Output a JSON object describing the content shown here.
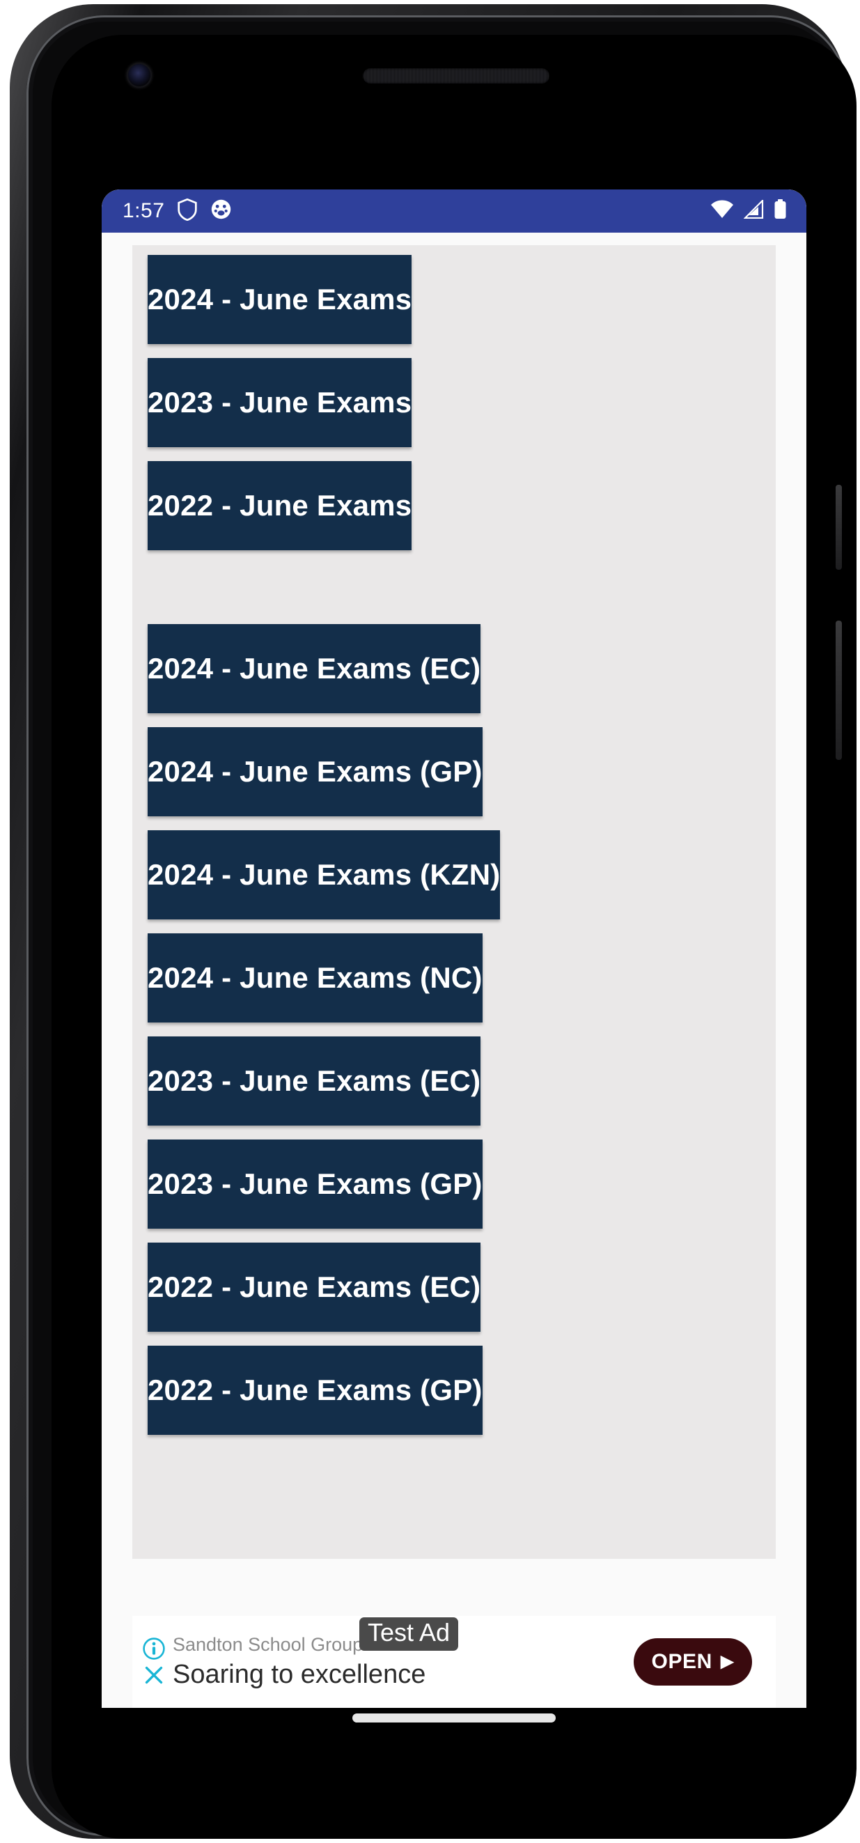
{
  "status_bar": {
    "time": "1:57",
    "left_icons": [
      "shield-icon",
      "pet-face-icon"
    ],
    "right_icons": [
      "wifi-icon",
      "cellular-signal-icon",
      "battery-icon"
    ],
    "background_color": "#2F409B"
  },
  "theme": {
    "button_color": "#132E4A",
    "button_text_color": "#FFFFFF",
    "content_background": "#EAE8E8",
    "page_background": "#FAFAFA",
    "ad_accent": "#19B5D5",
    "ad_cta_color": "#3A0A0E"
  },
  "main": {
    "primary_group": [
      {
        "label": "2024 - June Exams"
      },
      {
        "label": "2023 - June Exams"
      },
      {
        "label": "2022 - June Exams"
      }
    ],
    "regional_group": [
      {
        "label": "2024 - June Exams (EC)"
      },
      {
        "label": "2024 - June Exams (GP)"
      },
      {
        "label": "2024 - June Exams (KZN)"
      },
      {
        "label": "2024 - June Exams (NC)"
      },
      {
        "label": "2023 - June Exams (EC)"
      },
      {
        "label": "2023 - June Exams (GP)"
      },
      {
        "label": "2022 - June Exams (EC)"
      },
      {
        "label": "2022 - June Exams (GP)"
      }
    ]
  },
  "ad": {
    "advertiser": "Sandton School Group",
    "badge": "Test Ad",
    "headline": "Soaring to excellence",
    "cta_label": "OPEN",
    "cta_caret": "▶",
    "info_icon": "info-icon",
    "close_icon": "close-icon"
  }
}
